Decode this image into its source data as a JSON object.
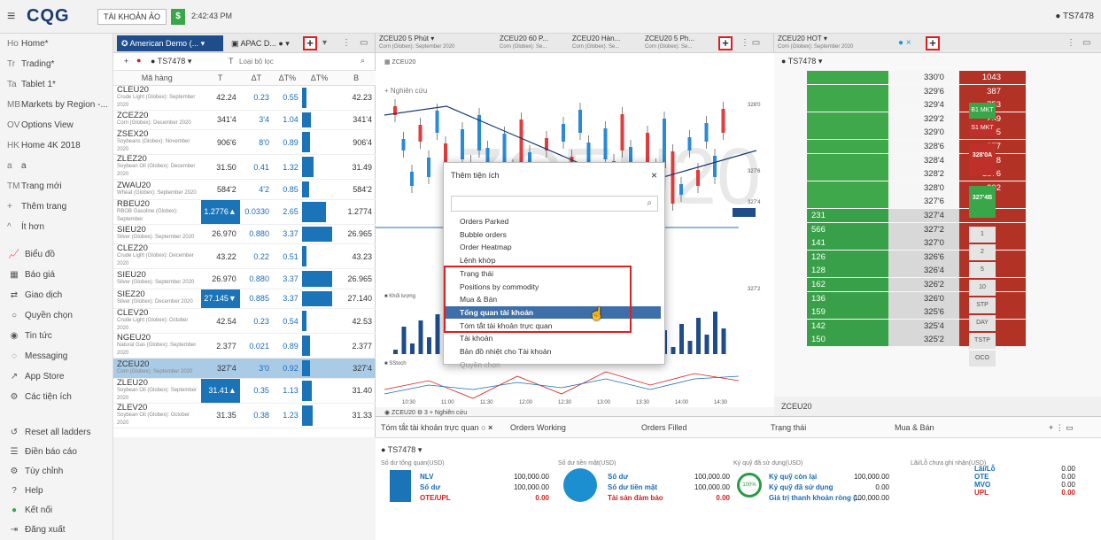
{
  "topbar": {
    "logo": "CQG",
    "account": "TÀI KHOẢN ẢO",
    "dollar": "$",
    "time": "2:42:43 PM",
    "user": "TS7478"
  },
  "sidebar": {
    "items": [
      {
        "abbr": "Ho",
        "label": "Home*"
      },
      {
        "abbr": "Tr",
        "label": "Trading*"
      },
      {
        "abbr": "Ta",
        "label": "Tablet 1*"
      },
      {
        "abbr": "MB",
        "label": "Markets by Region -..."
      },
      {
        "abbr": "OV",
        "label": "Options View"
      },
      {
        "abbr": "HK",
        "label": "Home 4K 2018"
      },
      {
        "abbr": "a",
        "label": "a"
      },
      {
        "abbr": "TM",
        "label": "Trang mới"
      },
      {
        "abbr": "+",
        "label": "Thêm trang"
      },
      {
        "abbr": "^",
        "label": "Ít hơn"
      }
    ],
    "tools": [
      "Biểu đồ",
      "Báo giá",
      "Giao dịch",
      "Quyền chọn",
      "Tin tức",
      "Messaging",
      "App Store",
      "Các tiện ích"
    ],
    "footer": [
      "Reset all ladders",
      "Điền báo cáo",
      "Tùy chỉnh",
      "Help",
      "Kết nối",
      "Đăng xuất"
    ]
  },
  "quotes": {
    "tab1": "American Demo (...",
    "tab2": "APAC D...",
    "plus": "+",
    "account": "TS7478",
    "filter_placeholder": "Loại bộ lọc",
    "headers": [
      "Mã hàng",
      "T",
      "ΔT",
      "ΔT%",
      "ΔT%",
      "B"
    ],
    "rows": [
      {
        "code": "CLEU20",
        "desc": "Crude Light (Globex): September 2020",
        "t": "42.24",
        "dt": "0.23",
        "dtp": "0.55",
        "bar": 0.55,
        "b": "42.23"
      },
      {
        "code": "ZCEZ20",
        "desc": "Corn (Globex): December 2020",
        "t": "341'4",
        "dt": "3'4",
        "dtp": "1.04",
        "bar": 1.04,
        "b": "341'4"
      },
      {
        "code": "ZSEX20",
        "desc": "Soybeans (Globex): November 2020",
        "t": "906'6",
        "dt": "8'0",
        "dtp": "0.89",
        "bar": 0.89,
        "b": "906'4"
      },
      {
        "code": "ZLEZ20",
        "desc": "Soybean Oil (Globex): December 2020",
        "t": "31.50",
        "dt": "0.41",
        "dtp": "1.32",
        "bar": 1.32,
        "b": "31.49"
      },
      {
        "code": "ZWAU20",
        "desc": "Wheat (Globex): September 2020",
        "t": "584'2",
        "dt": "4'2",
        "dtp": "0.85",
        "bar": 0.85,
        "b": "584'2"
      },
      {
        "code": "RBEU20",
        "desc": "RBOB Gasoline (Globex): September",
        "t": "1.2776▲",
        "dt": "0.0330",
        "dtp": "2.65",
        "bar": 2.65,
        "b": "1.2774",
        "hl": true
      },
      {
        "code": "SIEU20",
        "desc": "Silver (Globex): September 2020",
        "t": "26.970",
        "dt": "0.880",
        "dtp": "3.37",
        "bar": 3.37,
        "b": "26.965"
      },
      {
        "code": "CLEZ20",
        "desc": "Crude Light (Globex): December 2020",
        "t": "43.22",
        "dt": "0.22",
        "dtp": "0.51",
        "bar": 0.51,
        "b": "43.23"
      },
      {
        "code": "SIEU20",
        "desc": "Silver (Globex): September 2020",
        "t": "26.970",
        "dt": "0.880",
        "dtp": "3.37",
        "bar": 3.37,
        "b": "26.965"
      },
      {
        "code": "SIEZ20",
        "desc": "Silver (Globex): December 2020",
        "t": "27.145▼",
        "dt": "0.885",
        "dtp": "3.37",
        "bar": 3.37,
        "b": "27.140",
        "hl": true
      },
      {
        "code": "CLEV20",
        "desc": "Crude Light (Globex): October 2020",
        "t": "42.54",
        "dt": "0.23",
        "dtp": "0.54",
        "bar": 0.54,
        "b": "42.53"
      },
      {
        "code": "NGEU20",
        "desc": "Natural Gas (Globex): September 2020",
        "t": "2.377",
        "dt": "0.021",
        "dtp": "0.89",
        "bar": 0.89,
        "b": "2.377"
      },
      {
        "code": "ZCEU20",
        "desc": "Corn (Globex): September 2020",
        "t": "327'4",
        "dt": "3'0",
        "dtp": "0.92",
        "bar": 0.92,
        "b": "327'4",
        "sel": true
      },
      {
        "code": "ZLEU20",
        "desc": "Soybean Oil (Globex): September 2020",
        "t": "31.41▲",
        "dt": "0.35",
        "dtp": "1.13",
        "bar": 1.13,
        "b": "31.40",
        "hl": true
      },
      {
        "code": "ZLEV20",
        "desc": "Soybean Oil (Globex): October 2020",
        "t": "31.35",
        "dt": "0.38",
        "dtp": "1.23",
        "bar": 1.23,
        "b": "31.33"
      }
    ]
  },
  "chart": {
    "tabs": [
      {
        "title": "ZCEU20 5 Phút ▾",
        "sub": "Corn (Globex): September 2020"
      },
      {
        "title": "ZCEU20 60 P...",
        "sub": "Corn (Globex): Se..."
      },
      {
        "title": "ZCEU20 Hàn...",
        "sub": "Corn (Globex): Se..."
      },
      {
        "title": "ZCEU20 5 Ph...",
        "sub": "Corn (Globex): Se..."
      }
    ],
    "symbol_label": "ZCEU20",
    "study_label": "Nghiên cứu",
    "volume_label": "Khối lượng",
    "stoch_label": "SStoch",
    "price_labels": [
      "328'0",
      "327'6",
      "327'4",
      "327'2",
      "100"
    ],
    "time_labels": [
      "10:30",
      "11:00",
      "11:30",
      "12:00",
      "12:30",
      "13:00",
      "13:30",
      "14:00",
      "14:30"
    ],
    "footer_symbol": "ZCEU20",
    "footer_study": "Nghiên cứu",
    "footer_count": "3"
  },
  "dialog": {
    "title": "Thêm tiện ích",
    "close": "×",
    "search_icon": "⌕",
    "items": [
      "Orders Parked",
      "Bubble orders",
      "Order Heatmap",
      "Lệnh khớp",
      "Trạng thái",
      "Positions by commodity",
      "Mua & Bán",
      "Tổng quan tài khoản",
      "Tóm tắt tài khoản trực quan",
      "Tài khoản",
      "Bản đồ nhiệt cho Tài khoản",
      "Quyền chọn"
    ],
    "highlighted": "Tổng quan tài khoản"
  },
  "ladder": {
    "title": "ZCEU20 HOT ▾",
    "sub": "Corn (Globex): September 2020",
    "account": "TS7478",
    "rows": [
      {
        "price": "330'0",
        "buy": "",
        "sell": "1043"
      },
      {
        "price": "329'6",
        "buy": "",
        "sell": "387"
      },
      {
        "price": "329'4",
        "buy": "",
        "sell": "753"
      },
      {
        "price": "329'2",
        "buy": "",
        "sell": "239"
      },
      {
        "price": "329'0",
        "buy": "",
        "sell": "695"
      },
      {
        "price": "328'6",
        "buy": "",
        "sell": "277"
      },
      {
        "price": "328'4",
        "buy": "",
        "sell": "228"
      },
      {
        "price": "328'2",
        "buy": "",
        "sell": "1876"
      },
      {
        "price": "328'0",
        "buy": "",
        "sell": "302"
      },
      {
        "price": "327'6",
        "buy": "",
        "sell": ""
      },
      {
        "price": "327'4",
        "buy": "231",
        "sell": ""
      },
      {
        "price": "327'2",
        "buy": "566",
        "sell": ""
      },
      {
        "price": "327'0",
        "buy": "141",
        "sell": ""
      },
      {
        "price": "326'6",
        "buy": "126",
        "sell": ""
      },
      {
        "price": "326'4",
        "buy": "128",
        "sell": ""
      },
      {
        "price": "326'2",
        "buy": "162",
        "sell": ""
      },
      {
        "price": "326'0",
        "buy": "136",
        "sell": ""
      },
      {
        "price": "325'6",
        "buy": "159",
        "sell": ""
      },
      {
        "price": "325'4",
        "buy": "142",
        "sell": ""
      },
      {
        "price": "325'2",
        "buy": "150",
        "sell": ""
      }
    ],
    "buttons": {
      "b1": "B1 MKT",
      "s1": "S1 MKT",
      "ask": "328'0A",
      "ask_sub": "302",
      "bid": "327'4B",
      "bid_sub": "231",
      "qty": "1",
      "q2": "2",
      "q5": "5",
      "q10": "10",
      "stp": "STP",
      "day": "DAY",
      "tstp": "TSTP",
      "oco": "OCO"
    },
    "footer_symbol": "ZCEU20"
  },
  "bottom": {
    "tabs": [
      "Tóm tắt tài khoản trực quan",
      "Orders Working",
      "Orders Filled",
      "Trạng thái",
      "Mua & Bán"
    ],
    "account": "TS7478",
    "sections": [
      "Số dư tổng quan(USD)",
      "Số dư tiền mặt(USD)",
      "Ký quỹ đã sử dụng(USD)",
      "Lãi/Lỗ chưa ghi nhận(USD)"
    ],
    "s1": [
      {
        "label": "NLV",
        "value": "100,000.00"
      },
      {
        "label": "Số dư",
        "value": "100,000.00"
      },
      {
        "label": "OTE/UPL",
        "value": "0.00"
      }
    ],
    "s2": [
      {
        "label": "Số dư",
        "value": "100,000.00"
      },
      {
        "label": "Số dư tiền mặt",
        "value": "100,000.00"
      },
      {
        "label": "Tài sản đảm bảo",
        "value": "0.00"
      }
    ],
    "s3": [
      {
        "label": "Ký quỹ còn lại",
        "value": "100,000.00"
      },
      {
        "label": "Ký quỹ đã sử dụng",
        "value": "0.00"
      },
      {
        "label": "Giá trị thanh khoản ròng (...",
        "value": "100,000.00"
      }
    ],
    "s3_pct": "100%",
    "s4": [
      {
        "label": "Lãi/Lỗ",
        "value": "0.00"
      },
      {
        "label": "OTE",
        "value": "0.00"
      },
      {
        "label": "MVO",
        "value": "0.00"
      },
      {
        "label": "UPL",
        "value": "0.00"
      }
    ]
  }
}
